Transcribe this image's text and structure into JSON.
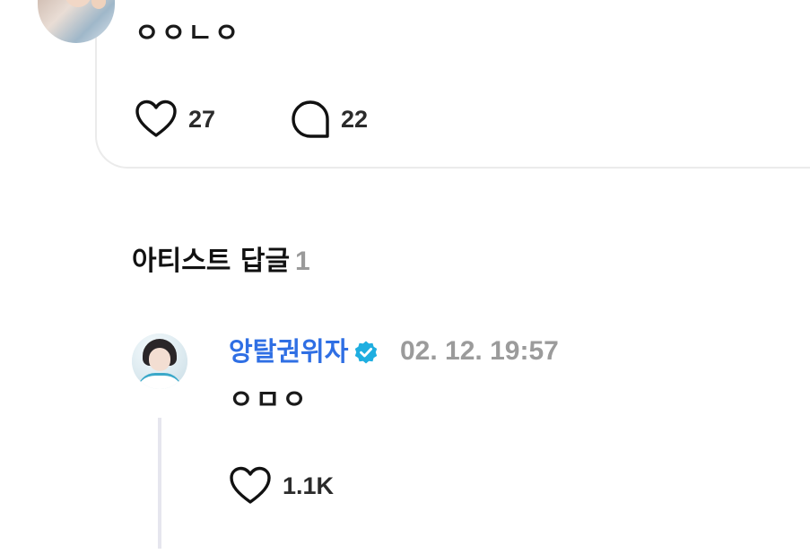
{
  "previous_comment": {
    "text": "ㅇㅇㄴㅇ",
    "likes": "27",
    "comments": "22"
  },
  "artist_replies": {
    "title": "아티스트 답글",
    "count": "1",
    "reply": {
      "author": "앙탈권위자",
      "timestamp": "02. 12. 19:57",
      "text": "ㅇㅁㅇ",
      "likes": "1.1K"
    }
  },
  "colors": {
    "author_name": "#2f6fe4",
    "verified_badge": "#1faee0",
    "muted": "#9b9b9b"
  },
  "icons": [
    "heart-icon",
    "comment-bubble-icon",
    "verified-badge-icon"
  ]
}
